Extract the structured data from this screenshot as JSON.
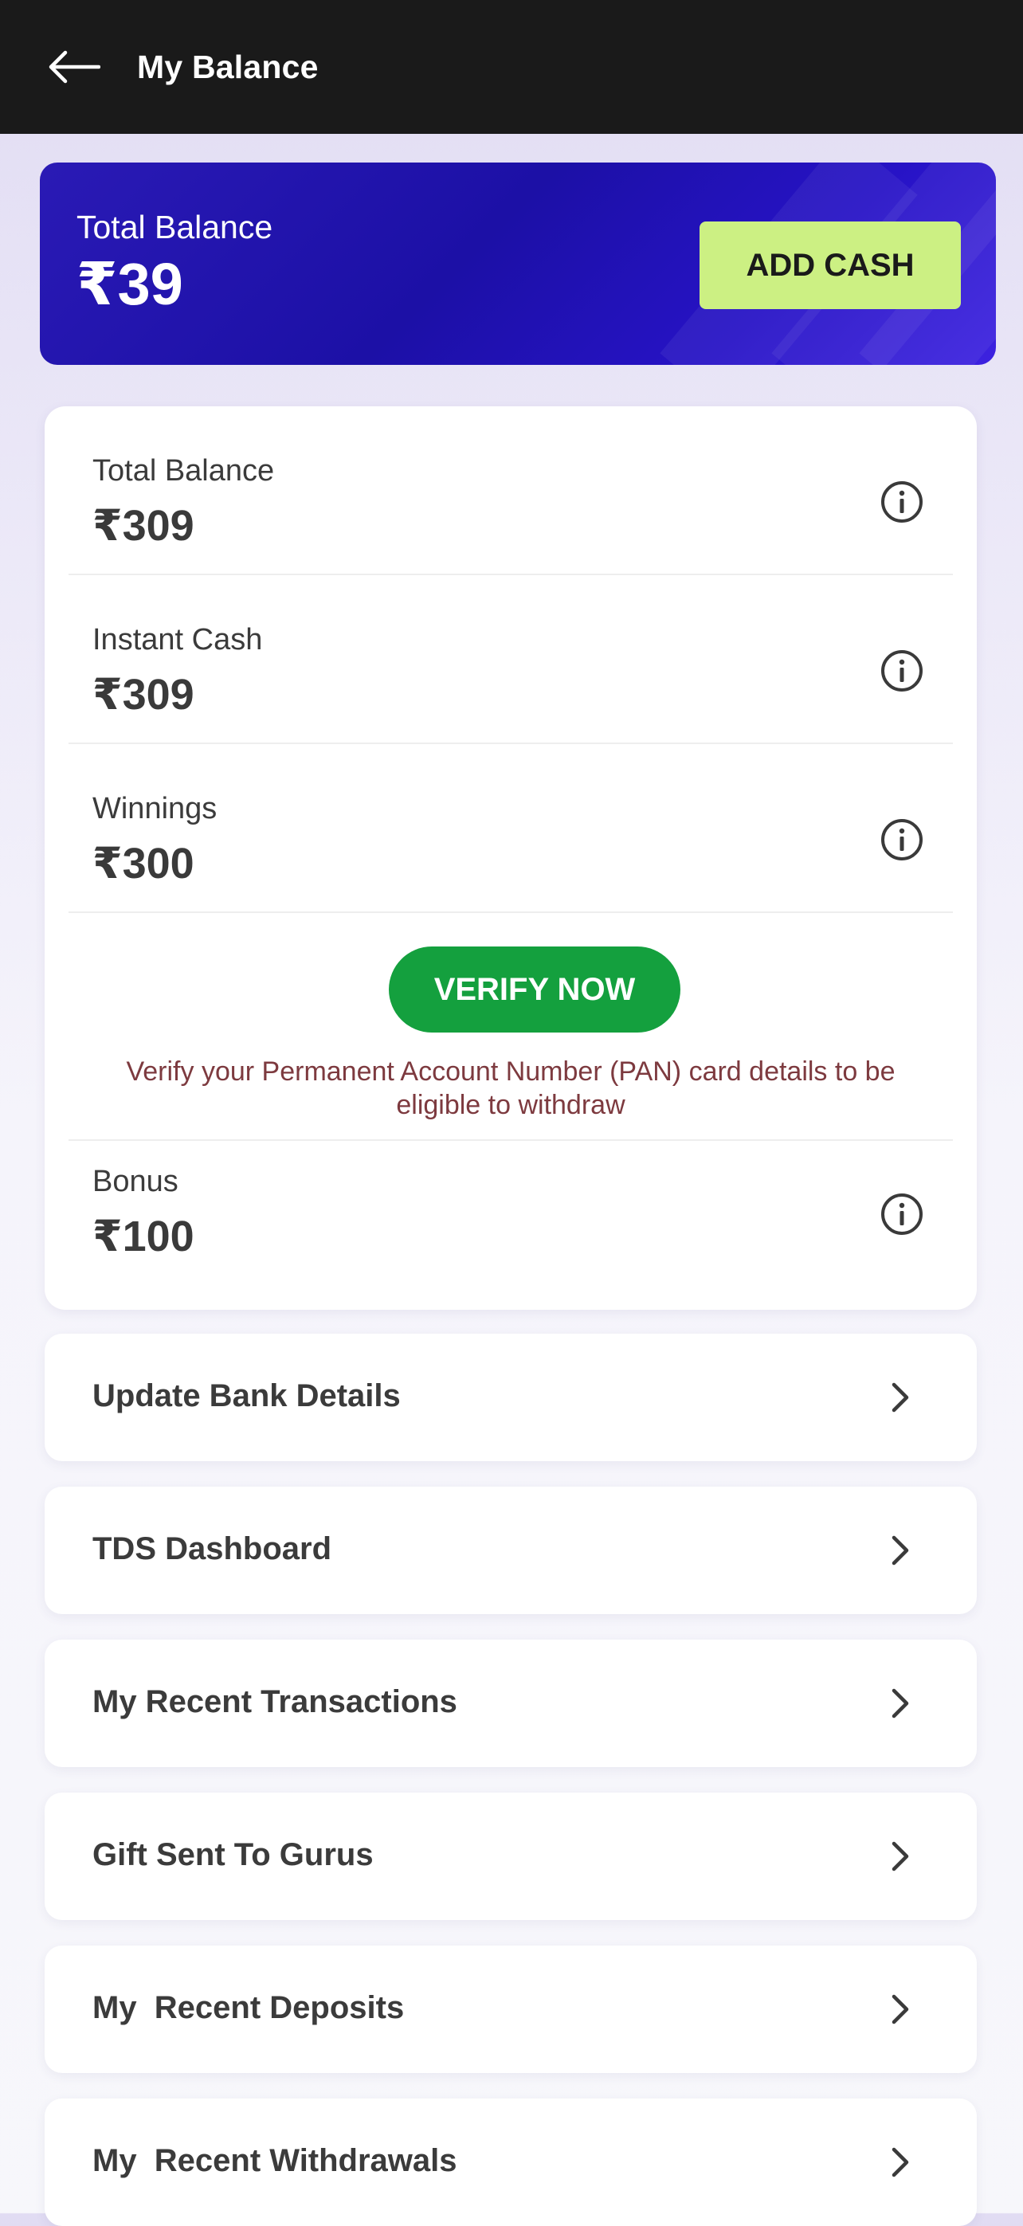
{
  "header": {
    "title": "My Balance",
    "back_icon": "arrow-left-icon"
  },
  "hero": {
    "label": "Total Balance",
    "amount": "₹39",
    "add_cash_label": "ADD CASH"
  },
  "balances": [
    {
      "label": "Total Balance",
      "value": "₹309",
      "icon": "info-icon"
    },
    {
      "label": "Instant Cash",
      "value": "₹309",
      "icon": "info-icon"
    },
    {
      "label": "Winnings",
      "value": "₹300",
      "icon": "info-icon"
    },
    {
      "label": "Bonus",
      "value": "₹100",
      "icon": "info-icon"
    }
  ],
  "verify": {
    "button_label": "VERIFY NOW",
    "note": "Verify your Permanent Account Number (PAN) card details to be eligible to withdraw"
  },
  "menu": [
    {
      "label": "Update Bank Details",
      "icon": "chevron-right-icon"
    },
    {
      "label": "TDS Dashboard",
      "icon": "chevron-right-icon"
    },
    {
      "label": "My Recent Transactions",
      "icon": "chevron-right-icon"
    },
    {
      "label": "Gift Sent To Gurus",
      "icon": "chevron-right-icon"
    },
    {
      "label": "My  Recent Deposits",
      "icon": "chevron-right-icon"
    },
    {
      "label": "My  Recent Withdrawals",
      "icon": "chevron-right-icon"
    }
  ],
  "colors": {
    "appbar": "#1a1a1a",
    "hero_bg": "#1c10a6",
    "add_cash_bg": "#ccf083",
    "verify_bg": "#14a03e",
    "verify_note": "#7d3a3f"
  }
}
